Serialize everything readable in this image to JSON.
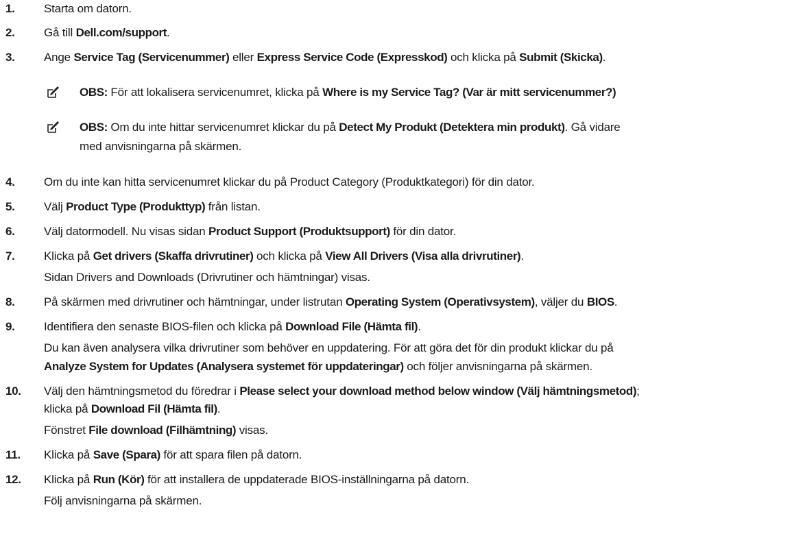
{
  "steps": [
    {
      "num": "1.",
      "parts": [
        {
          "t": "Starta om datorn.",
          "b": false
        }
      ]
    },
    {
      "num": "2.",
      "parts": [
        {
          "t": "Gå till ",
          "b": false
        },
        {
          "t": "Dell.com/support",
          "b": true
        },
        {
          "t": ".",
          "b": false
        }
      ]
    },
    {
      "num": "3.",
      "parts": [
        {
          "t": "Ange ",
          "b": false
        },
        {
          "t": "Service Tag (Servicenummer)",
          "b": true
        },
        {
          "t": " eller ",
          "b": false
        },
        {
          "t": "Express Service Code (Expresskod)",
          "b": true
        },
        {
          "t": " och klicka på ",
          "b": false
        },
        {
          "t": "Submit (Skicka)",
          "b": true
        },
        {
          "t": ".",
          "b": false
        }
      ]
    },
    {
      "num": "4.",
      "parts": [
        {
          "t": "Om du inte kan hitta servicenumret klickar du på Product Category (Produktkategori) för din dator.",
          "b": false
        }
      ]
    },
    {
      "num": "5.",
      "parts": [
        {
          "t": "Välj ",
          "b": false
        },
        {
          "t": "Product Type (Produkttyp)",
          "b": true
        },
        {
          "t": " från listan.",
          "b": false
        }
      ]
    },
    {
      "num": "6.",
      "parts": [
        {
          "t": "Välj datormodell. Nu visas sidan ",
          "b": false
        },
        {
          "t": "Product Support (Produktsupport)",
          "b": true
        },
        {
          "t": " för din dator.",
          "b": false
        }
      ]
    },
    {
      "num": "7.",
      "parts": [
        {
          "t": "Klicka på ",
          "b": false
        },
        {
          "t": "Get drivers (Skaffa drivrutiner)",
          "b": true
        },
        {
          "t": " och klicka på ",
          "b": false
        },
        {
          "t": "View All Drivers (Visa alla drivrutiner)",
          "b": true
        },
        {
          "t": ".",
          "b": false
        }
      ]
    },
    {
      "num": "",
      "parts": [
        {
          "t": "Sidan Drivers and Downloads (Drivrutiner och hämtningar) visas.",
          "b": false
        }
      ]
    },
    {
      "num": "8.",
      "parts": [
        {
          "t": "På skärmen med drivrutiner och hämtningar, under listrutan ",
          "b": false
        },
        {
          "t": "Operating System (Operativsystem)",
          "b": true
        },
        {
          "t": ", väljer du ",
          "b": false
        },
        {
          "t": "BIOS",
          "b": true
        },
        {
          "t": ".",
          "b": false
        }
      ]
    },
    {
      "num": "9.",
      "parts": [
        {
          "t": "Identifiera den senaste BIOS-filen och klicka på ",
          "b": false
        },
        {
          "t": "Download File (Hämta fil)",
          "b": true
        },
        {
          "t": ".",
          "b": false
        }
      ]
    },
    {
      "num": "",
      "parts": [
        {
          "t": "Du kan även analysera vilka drivrutiner som behöver en uppdatering. För att göra det för din produkt klickar du på",
          "b": false
        }
      ]
    },
    {
      "num": "",
      "parts": [
        {
          "t": "Analyze System for Updates (Analysera systemet för uppdateringar)",
          "b": true
        },
        {
          "t": " och följer anvisningarna på skärmen.",
          "b": false
        }
      ]
    },
    {
      "num": "10.",
      "parts": [
        {
          "t": "Välj den hämtningsmetod du föredrar i ",
          "b": false
        },
        {
          "t": "Please select your download method below window (Välj hämtningsmetod)",
          "b": true
        },
        {
          "t": ";",
          "b": false
        }
      ]
    },
    {
      "num": "",
      "parts": [
        {
          "t": "klicka på ",
          "b": false
        },
        {
          "t": "Download Fil (Hämta fil)",
          "b": true
        },
        {
          "t": ".",
          "b": false
        }
      ]
    },
    {
      "num": "",
      "parts": [
        {
          "t": "Fönstret ",
          "b": false
        },
        {
          "t": "File download (Filhämtning)",
          "b": true
        },
        {
          "t": " visas.",
          "b": false
        }
      ]
    },
    {
      "num": "11.",
      "parts": [
        {
          "t": "Klicka på ",
          "b": false
        },
        {
          "t": "Save (Spara)",
          "b": true
        },
        {
          "t": " för att spara filen på datorn.",
          "b": false
        }
      ]
    },
    {
      "num": "12.",
      "parts": [
        {
          "t": "Klicka på ",
          "b": false
        },
        {
          "t": "Run (Kör)",
          "b": true
        },
        {
          "t": " för att installera de uppdaterade BIOS-inställningarna på datorn.",
          "b": false
        }
      ]
    },
    {
      "num": "",
      "parts": [
        {
          "t": "Följ anvisningarna på skärmen.",
          "b": false
        }
      ]
    }
  ],
  "notes": [
    {
      "lines": [
        [
          {
            "t": "OBS:",
            "b": true
          },
          {
            "t": " För att lokalisera servicenumret, klicka på ",
            "b": false
          },
          {
            "t": "Where is my Service Tag? (Var är mitt servicenummer?)",
            "b": true
          }
        ]
      ]
    },
    {
      "lines": [
        [
          {
            "t": "OBS:",
            "b": true
          },
          {
            "t": " Om du inte hittar servicenumret klickar du på ",
            "b": false
          },
          {
            "t": "Detect My Produkt (Detektera min produkt)",
            "b": true
          },
          {
            "t": ". Gå vidare",
            "b": false
          }
        ],
        [
          {
            "t": "med anvisningarna på skärmen.",
            "b": false
          }
        ]
      ]
    }
  ],
  "icons": {
    "note": "note-pencil-icon"
  }
}
